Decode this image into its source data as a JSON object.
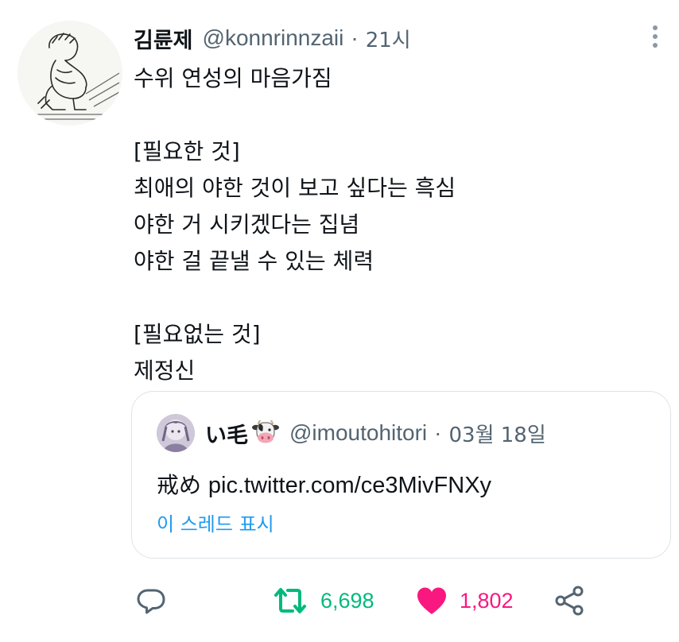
{
  "tweet": {
    "author": {
      "display_name": "김륜제",
      "handle": "@konnrinnzaii",
      "separator": "·",
      "time": "21시"
    },
    "body_lines": [
      "수위 연성의 마음가짐",
      "",
      "[필요한 것]",
      "최애의 야한 것이 보고 싶다는 흑심",
      "야한 거 시키겠다는 집념",
      "야한 걸 끝낼 수 있는 체력",
      "",
      "[필요없는 것]",
      "제정신"
    ],
    "quoted": {
      "display_name": "い毛",
      "name_emoji_icon": "cow-face-icon",
      "handle": "@imoutohitori",
      "separator": "·",
      "time": "03월 18일",
      "text_prefix": "戒め",
      "text_link": "pic.twitter.com/ce3MivFNXy",
      "show_thread_label": "이 스레드 표시"
    },
    "actions": {
      "reply_icon": "reply-bubble-icon",
      "retweet_icon": "retweet-icon",
      "retweet_count": "6,698",
      "like_icon": "heart-icon",
      "like_count": "1,802",
      "share_icon": "share-icon"
    }
  },
  "colors": {
    "text_primary": "#0f1419",
    "text_secondary": "#536471",
    "link_blue": "#1d9bf0",
    "retweet_green": "#00ba7c",
    "like_pink": "#f91880",
    "border": "#dfe3e6"
  }
}
